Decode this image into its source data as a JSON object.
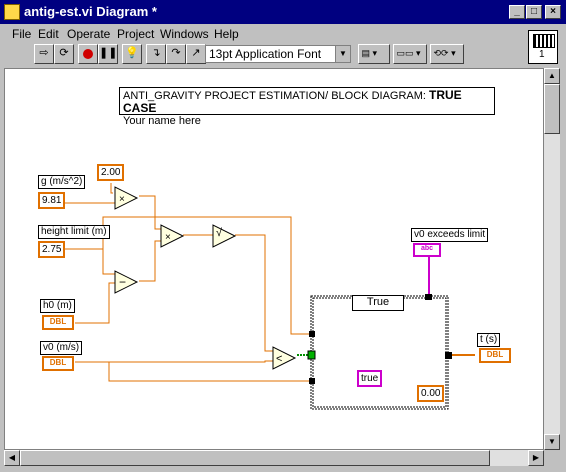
{
  "window": {
    "title": "antig-est.vi Diagram *",
    "minimize": "_",
    "maximize": "□",
    "close": "×"
  },
  "menu": [
    "File",
    "Edit",
    "Operate",
    "Project",
    "Windows",
    "Help"
  ],
  "toolbar": {
    "font_select": "13pt Application Font",
    "connector_number": "1"
  },
  "diagram": {
    "comment_title": "ANTI_GRAVITY PROJECT ESTIMATION/ BLOCK DIAGRAM: ",
    "comment_case": "TRUE CASE",
    "comment_sub": "Your name here",
    "const_two": "2.00",
    "g_label": "g (m/s^2)",
    "g_value": "9.81",
    "height_label": "height limit (m)",
    "height_value": "2.75",
    "h0_label": "h0 (m)",
    "v0_label": "v0 (m/s)",
    "dbl": "DBL",
    "exceeds_label": "v0 exceeds limit",
    "abc": "abc",
    "case_value": "True",
    "true_const": "true",
    "zero_const": "0.00",
    "t_label": "t (s)",
    "sqrt_glyph": "√"
  },
  "colors": {
    "numeric_wire": "#e07000",
    "string_wire": "#cc00cc",
    "boolean_wire": "#009000",
    "titlebar": "#000080"
  }
}
